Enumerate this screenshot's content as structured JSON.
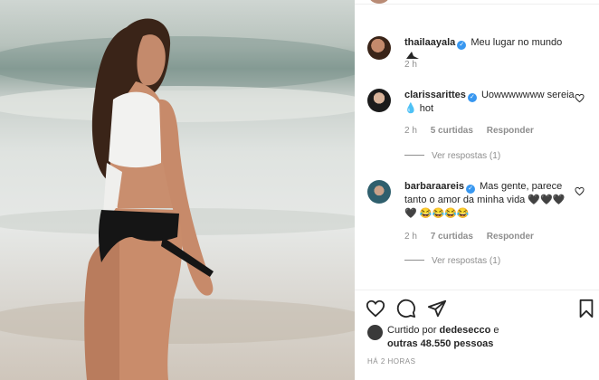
{
  "post": {
    "author": "thailaayala",
    "caption": "Meu lugar no mundo",
    "time": "2 h"
  },
  "comments": [
    {
      "username": "clarissarittes",
      "text": "Uowwwwwww sereia 💧 hot",
      "time": "2 h",
      "likes": "5 curtidas",
      "reply": "Responder",
      "view_replies": "Ver respostas (1)"
    },
    {
      "username": "barbaraareis",
      "text": "Mas gente, parece tanto o amor da minha vida 🖤🖤🖤🖤 😂😂😂😂",
      "time": "2 h",
      "likes": "7 curtidas",
      "reply": "Responder",
      "view_replies": "Ver respostas (1)"
    }
  ],
  "likes": {
    "prefix": "Curtido por",
    "user": "dedesecco",
    "connector": "e",
    "others": "outras 48.550 pessoas"
  },
  "timestamp": "HÁ 2 HORAS",
  "icons": [
    "heart-icon",
    "comment-icon",
    "share-icon",
    "bookmark-icon",
    "verified-icon",
    "shark-emoji-icon"
  ]
}
